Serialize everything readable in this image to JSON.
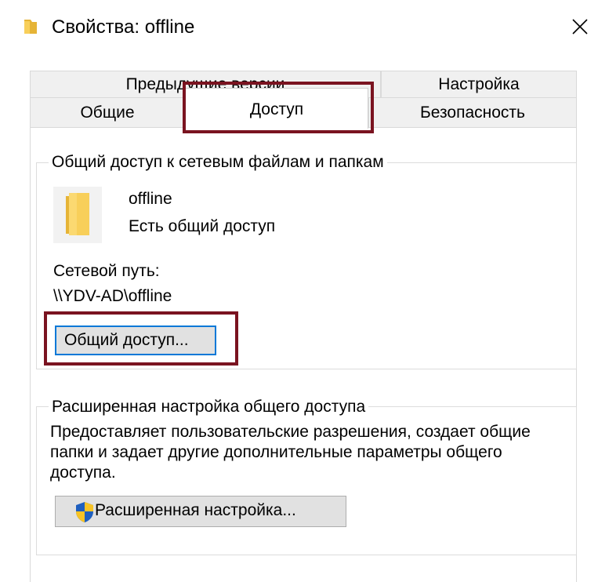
{
  "window": {
    "title": "Свойства: offline",
    "title_icon": "folder-icon",
    "close_icon": "close-icon"
  },
  "tabs": {
    "row1": [
      {
        "label": "Предыдущие версии"
      },
      {
        "label": "Настройка"
      }
    ],
    "row2": [
      {
        "label": "Общие"
      },
      {
        "label": "Доступ",
        "active": true
      },
      {
        "label": "Безопасность"
      }
    ]
  },
  "network_share": {
    "legend": "Общий доступ к сетевым файлам и папкам",
    "folder_name": "offline",
    "status": "Есть общий доступ",
    "path_label": "Сетевой путь:",
    "path_value": "\\\\YDV-AD\\offline",
    "share_button_label": "Общий доступ..."
  },
  "advanced": {
    "legend": "Расширенная настройка общего доступа",
    "description": "Предоставляет пользовательские разрешения, создает общие папки и задает другие дополнительные параметры общего доступа.",
    "button_label": "Расширенная настройка...",
    "button_icon": "uac-shield-icon"
  },
  "colors": {
    "highlight": "#7a1320",
    "folder": "#f8cf5a",
    "focus_border": "#0078d7"
  }
}
